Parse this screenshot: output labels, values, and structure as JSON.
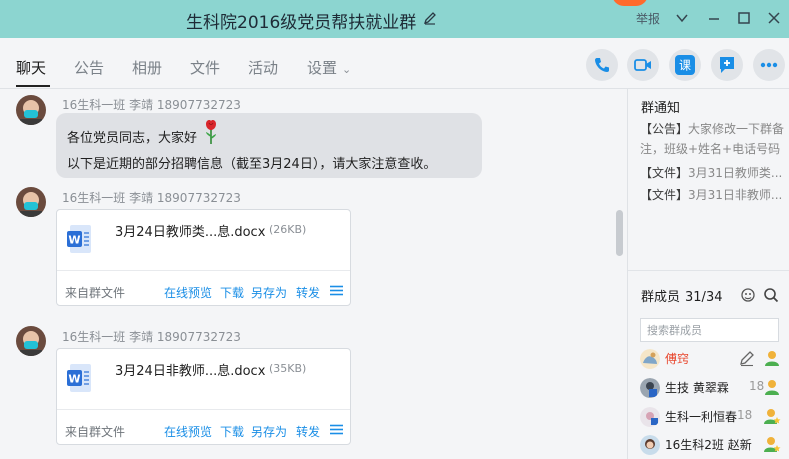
{
  "window": {
    "title": "生科院2016级党员帮扶就业群",
    "report_label": "举报"
  },
  "tabs": [
    {
      "label": "聊天",
      "active": true
    },
    {
      "label": "公告",
      "active": false
    },
    {
      "label": "相册",
      "active": false
    },
    {
      "label": "文件",
      "active": false
    },
    {
      "label": "活动",
      "active": false
    },
    {
      "label": "设置",
      "active": false
    }
  ],
  "action_buttons": {
    "call": "phone-icon",
    "video": "video-icon",
    "course": "课",
    "add": "add-chat-icon",
    "more": "more-icon"
  },
  "messages": [
    {
      "sender": "16生科一班  李靖  18907732723",
      "type": "text",
      "line1": "各位党员同志，大家好",
      "line2": "以下是近期的部分招聘信息（截至3月24日），请大家注意查收。"
    },
    {
      "sender": "16生科一班  李靖  18907732723",
      "type": "file",
      "file_name": "3月24日教师类...息.docx",
      "file_size": "(26KB)",
      "source": "来自群文件",
      "actions": [
        "在线预览",
        "下载",
        "另存为",
        "转发"
      ]
    },
    {
      "sender": "16生科一班  李靖  18907732723",
      "type": "file",
      "file_name": "3月24日非教师...息.docx",
      "file_size": "(35KB)",
      "source": "来自群文件",
      "actions": [
        "在线预览",
        "下载",
        "另存为",
        "转发"
      ]
    }
  ],
  "sidebar": {
    "notice_title": "群通知",
    "notices": [
      {
        "tag": "【公告】",
        "text": "大家修改一下群备"
      },
      {
        "tag": "",
        "text": "注，班级+姓名+电话号码"
      },
      {
        "tag": "【文件】",
        "text": "3月31日教师类..."
      },
      {
        "tag": "【文件】",
        "text": "3月31日非教师..."
      }
    ],
    "members_title": "群成员",
    "members_count": "31/34",
    "search_placeholder": "搜索群成员",
    "members": [
      {
        "name": "傅窍",
        "extra": "",
        "name_color": "#e8452c"
      },
      {
        "name": "生技  黄翠霖",
        "extra": "18",
        "name_color": "#1f1f1f"
      },
      {
        "name": "生科一利恒春",
        "extra": "18",
        "name_color": "#1f1f1f"
      },
      {
        "name": "16生科2班  赵新",
        "extra": "",
        "name_color": "#1f1f1f"
      }
    ]
  },
  "colors": {
    "titlebar": "#8cd5d0",
    "link": "#1a8ee6",
    "word_blue": "#2b6fd6"
  }
}
